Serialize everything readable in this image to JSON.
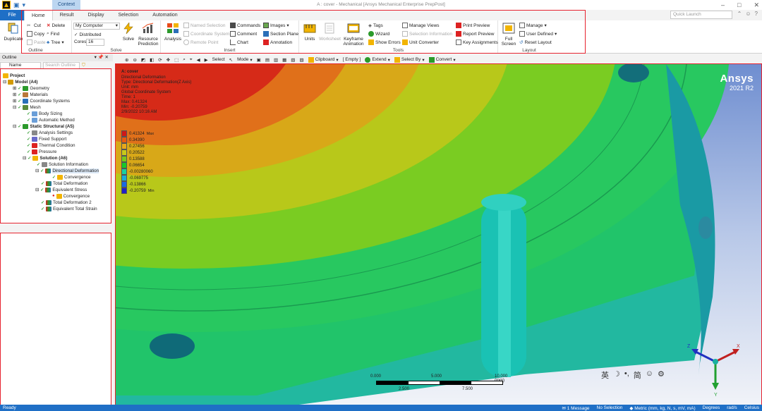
{
  "window": {
    "title": "A : cover - Mechanical [Ansys Mechanical Enterprise PrepPost]",
    "context_tab": "Context"
  },
  "tabs": [
    "File",
    "Home",
    "Result",
    "Display",
    "Selection",
    "Automation"
  ],
  "quick_launch_placeholder": "Quick Launch",
  "ribbon": {
    "outline": {
      "label": "Outline",
      "duplicate": "Duplicate",
      "cut": "Cut",
      "copy": "Copy",
      "paste": "Paste",
      "delete": "Delete",
      "find": "Find",
      "tree": "Tree"
    },
    "solve": {
      "label": "Solve",
      "computer": "My Computer",
      "distributed": "Distributed",
      "cores_label": "Cores",
      "cores_value": "16",
      "solve_btn": "Solve",
      "resource_prediction": "Resource Prediction"
    },
    "insert": {
      "label": "Insert",
      "analysis": "Analysis",
      "named_selection": "Named Selection",
      "coordinate_system": "Coordinate System",
      "remote_point": "Remote Point",
      "commands": "Commands",
      "comment": "Comment",
      "chart": "Chart",
      "images": "Images",
      "section_plane": "Section Plane",
      "annotation": "Annotation"
    },
    "tools": {
      "label": "Tools",
      "units": "Units",
      "worksheet": "Worksheet",
      "keyframe_animation": "Keyframe Animation",
      "tags": "Tags",
      "wizard": "Wizard",
      "show_errors": "Show Errors",
      "manage_views": "Manage Views",
      "selection_information": "Selection Information",
      "unit_converter": "Unit Converter",
      "print_preview": "Print Preview",
      "report_preview": "Report Preview",
      "key_assignments": "Key Assignments"
    },
    "layout": {
      "label": "Layout",
      "full_screen": "Full Screen",
      "manage": "Manage",
      "user_defined": "User Defined",
      "reset_layout": "Reset Layout"
    }
  },
  "toolbar": {
    "select": "Select",
    "mode": "Mode",
    "clipboard": "Clipboard",
    "empty": "[ Empty ]",
    "extend": "Extend",
    "select_by": "Select By",
    "convert": "Convert"
  },
  "outline_panel": {
    "title": "Outline",
    "name_col": "Name",
    "search_placeholder": "Search Outline"
  },
  "tree": [
    {
      "label": "Project",
      "bold": true
    },
    {
      "label": "Model (A4)",
      "bold": true
    },
    {
      "label": "Geometry"
    },
    {
      "label": "Materials"
    },
    {
      "label": "Coordinate Systems"
    },
    {
      "label": "Mesh"
    },
    {
      "label": "Body Sizing"
    },
    {
      "label": "Automatic Method"
    },
    {
      "label": "Static Structural (A5)",
      "bold": true
    },
    {
      "label": "Analysis Settings"
    },
    {
      "label": "Fixed Support"
    },
    {
      "label": "Thermal Condition"
    },
    {
      "label": "Pressure"
    },
    {
      "label": "Solution (A6)",
      "bold": true
    },
    {
      "label": "Solution Information"
    },
    {
      "label": "Directional Deformation"
    },
    {
      "label": "Convergence"
    },
    {
      "label": "Total Deformation"
    },
    {
      "label": "Equivalent Stress"
    },
    {
      "label": "Convergence"
    },
    {
      "label": "Total Deformation 2"
    },
    {
      "label": "Equivalent Total Strain"
    }
  ],
  "viewport": {
    "result_title": "A: cover",
    "result_lines": [
      "Directional Deformation",
      "Type: Directional Deformation(Z Axis)",
      "Unit: mm",
      "Global Coordinate System",
      "Time: 1",
      "Max: 0.41324",
      "Min: -0.20759",
      "2/9/2022 10:16 AM"
    ],
    "legend_values": [
      "0.41324",
      "0.34390",
      "0.27456",
      "0.20522",
      "0.13588",
      "0.06654",
      "-0.00280060",
      "-0.069775",
      "-0.13866",
      "-0.20759"
    ],
    "legend_colors": [
      "#d01818",
      "#e85a10",
      "#e8a81a",
      "#c8c81a",
      "#7ac81a",
      "#1ac828",
      "#1ad0a0",
      "#1aaed8",
      "#1a6ae0",
      "#2020c8"
    ],
    "brand_name": "Ansys",
    "brand_version": "2021 R2",
    "scale_top": [
      "0.000",
      "5.000",
      "10.000 (mm)"
    ],
    "scale_bottom": [
      "2.500",
      "7.500"
    ],
    "ime_chars": [
      "英",
      "☽",
      "•,",
      "简",
      "☺",
      "⚙"
    ],
    "triad_labels": [
      "Z",
      "X",
      "Y"
    ]
  },
  "status": {
    "ready": "Ready",
    "messages": "1 Message",
    "selection": "No Selection",
    "units": "Metric (mm, kg, N, s, mV, mA)",
    "angle": "Degrees",
    "ang_vel": "rad/s",
    "temp": "Celsius"
  }
}
